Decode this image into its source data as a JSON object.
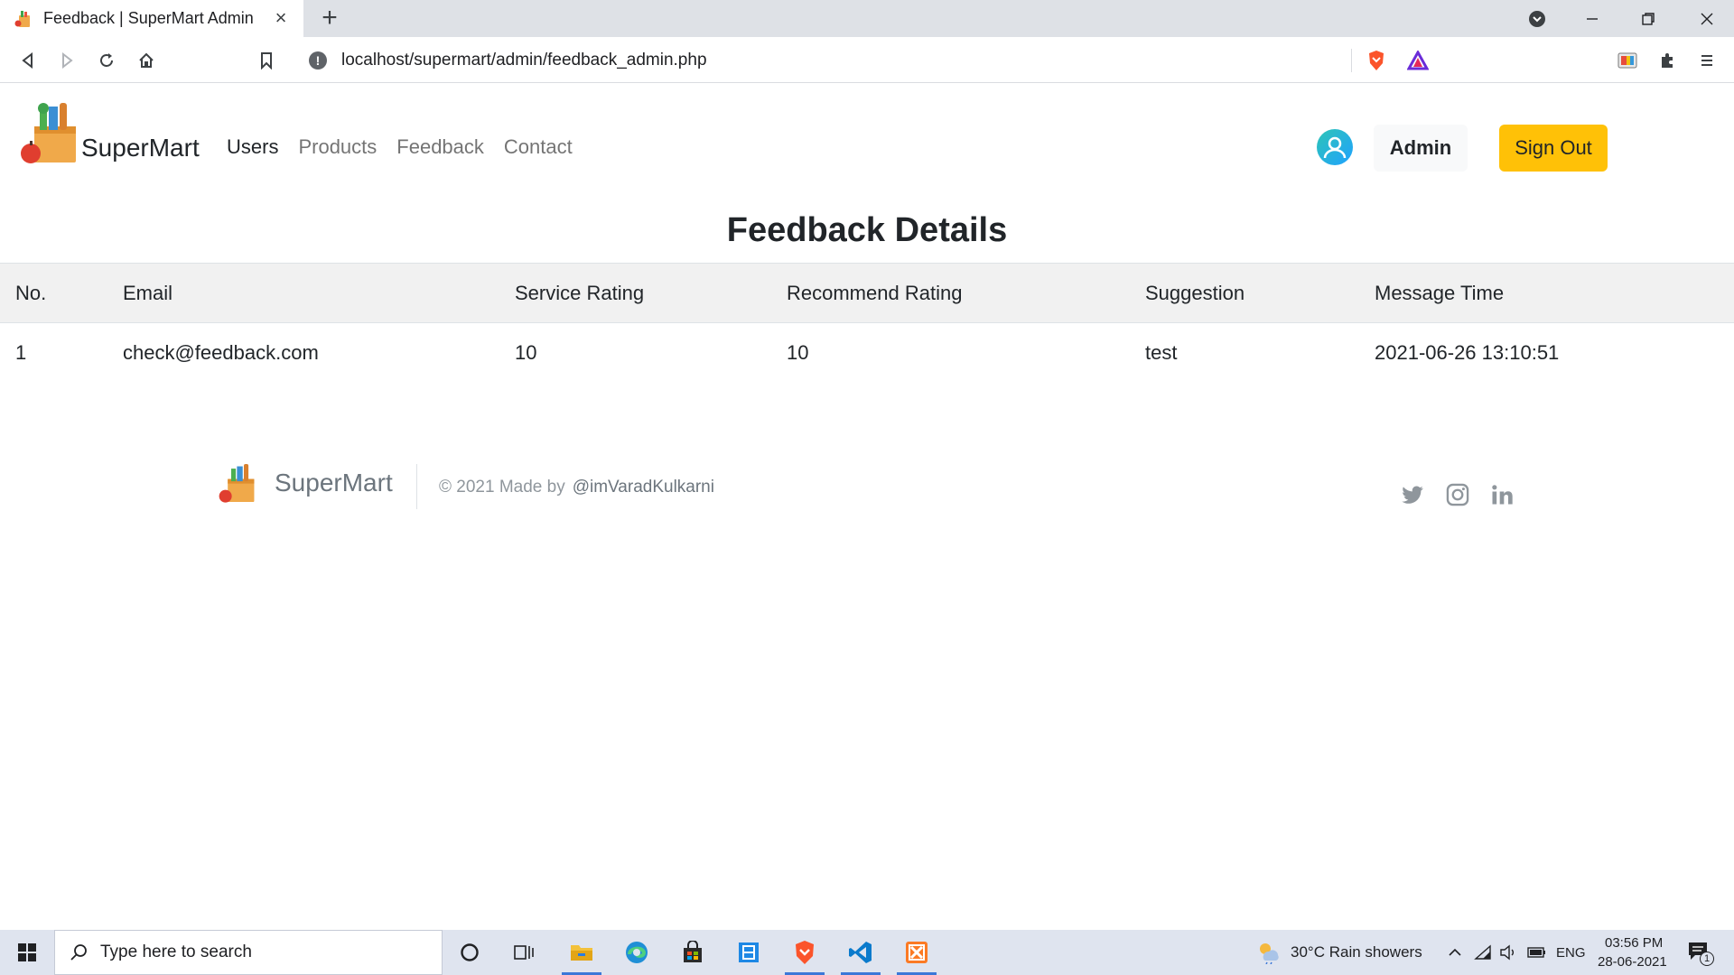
{
  "browser": {
    "tab_title": "Feedback | SuperMart Admin",
    "url": "localhost/supermart/admin/feedback_admin.php"
  },
  "navbar": {
    "brand": "SuperMart",
    "links": [
      {
        "label": "Users",
        "active": true
      },
      {
        "label": "Products",
        "active": false
      },
      {
        "label": "Feedback",
        "active": false
      },
      {
        "label": "Contact",
        "active": false
      }
    ],
    "admin_label": "Admin",
    "signout_label": "Sign Out"
  },
  "main": {
    "title": "Feedback Details",
    "table": {
      "columns": [
        "No.",
        "Email",
        "Service Rating",
        "Recommend Rating",
        "Suggestion",
        "Message Time"
      ],
      "rows": [
        [
          "1",
          "check@feedback.com",
          "10",
          "10",
          "test",
          "2021-06-26 13:10:51"
        ]
      ]
    }
  },
  "footer": {
    "brand": "SuperMart",
    "copyright": "© 2021 Made by",
    "handle": "@imVaradKulkarni",
    "social": [
      "twitter-icon",
      "instagram-icon",
      "linkedin-icon"
    ]
  },
  "taskbar": {
    "search_placeholder": "Type here to search",
    "weather": "30°C  Rain showers",
    "language": "ENG",
    "time": "03:56 PM",
    "date": "28-06-2021",
    "notification_count": "1"
  },
  "colors": {
    "signout_bg": "#ffc107",
    "table_header_bg": "#f1f1f1",
    "accent_taskbar": "#3c78d8"
  }
}
